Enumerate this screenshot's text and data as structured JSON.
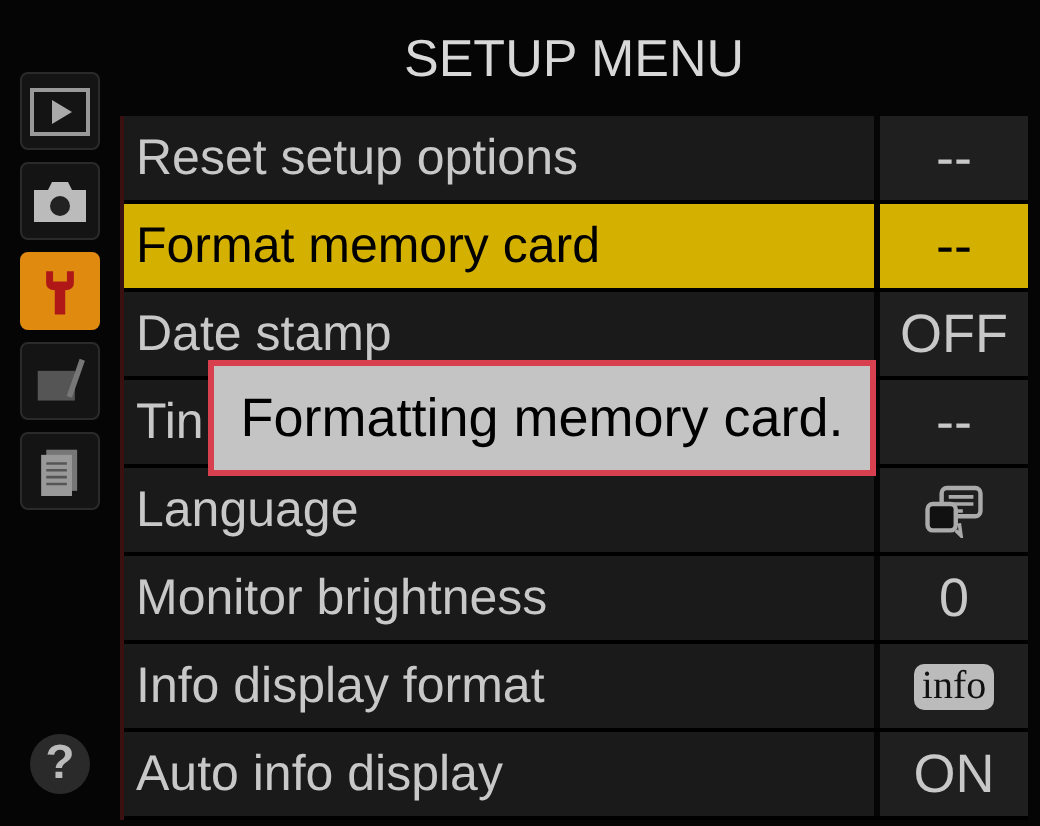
{
  "title": "SETUP MENU",
  "tabs": [
    {
      "kind": "playback",
      "selected": false
    },
    {
      "kind": "camera",
      "selected": false
    },
    {
      "kind": "setup",
      "selected": true
    },
    {
      "kind": "retouch",
      "selected": false
    },
    {
      "kind": "recent",
      "selected": false
    }
  ],
  "help": "?",
  "items": [
    {
      "label": "Reset setup options",
      "value": {
        "kind": "text",
        "text": "--"
      },
      "selected": false
    },
    {
      "label": "Format memory card",
      "value": {
        "kind": "text",
        "text": "--"
      },
      "selected": true
    },
    {
      "label": "Date stamp",
      "value": {
        "kind": "text",
        "text": "OFF"
      },
      "selected": false
    },
    {
      "label": "Tin",
      "value": {
        "kind": "text",
        "text": "--"
      },
      "selected": false
    },
    {
      "label": "Language",
      "value": {
        "kind": "icon"
      },
      "selected": false
    },
    {
      "label": "Monitor brightness",
      "value": {
        "kind": "text",
        "text": "0"
      },
      "selected": false
    },
    {
      "label": "Info display format",
      "value": {
        "kind": "badge",
        "text": "info"
      },
      "selected": false
    },
    {
      "label": "Auto info display",
      "value": {
        "kind": "text",
        "text": "ON"
      },
      "selected": false
    }
  ],
  "dialog": {
    "message": "Formatting memory card."
  }
}
